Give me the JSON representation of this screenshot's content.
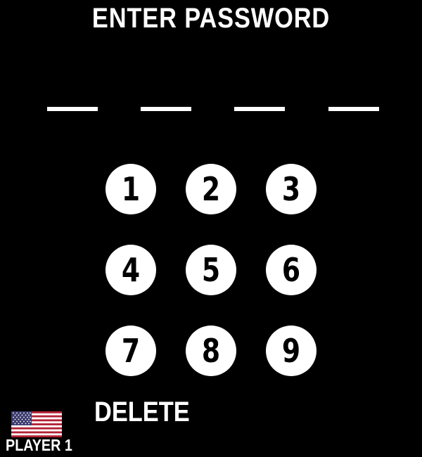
{
  "screen": {
    "title": "ENTER PASSWORD",
    "password_slot_count": 4,
    "entered_digits": [
      "",
      "",
      "",
      ""
    ]
  },
  "keypad": {
    "keys": [
      "1",
      "2",
      "3",
      "4",
      "5",
      "6",
      "7",
      "8",
      "9"
    ],
    "delete_label": "DELETE"
  },
  "player": {
    "label": "PLAYER 1",
    "flag_icon": "us-flag-icon"
  },
  "colors": {
    "background": "#000000",
    "foreground": "#ffffff"
  }
}
